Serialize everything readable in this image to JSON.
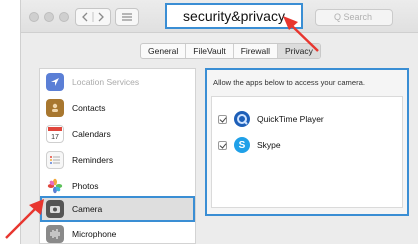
{
  "window": {
    "title": "security&privacy",
    "search_placeholder": "Q Search",
    "nav_back": "<",
    "nav_forward": ">"
  },
  "tabs": [
    {
      "label": "General",
      "active": false
    },
    {
      "label": "FileVault",
      "active": false
    },
    {
      "label": "Firewall",
      "active": false
    },
    {
      "label": "Privacy",
      "active": true
    }
  ],
  "sidebar": {
    "items": [
      {
        "label": "Location Services",
        "icon": "location-arrow-icon",
        "color": "#5b7fd6"
      },
      {
        "label": "Contacts",
        "icon": "contacts-book-icon",
        "color": "#a8772f"
      },
      {
        "label": "Calendars",
        "icon": "calendar-icon",
        "color": "#e0463c"
      },
      {
        "label": "Reminders",
        "icon": "reminders-list-icon",
        "color": "#f0f0f0"
      },
      {
        "label": "Photos",
        "icon": "photos-flower-icon",
        "color": "#f2a93b"
      },
      {
        "label": "Camera",
        "icon": "camera-icon",
        "color": "#555555"
      },
      {
        "label": "Microphone",
        "icon": "microphone-icon",
        "color": "#8a8a8a"
      }
    ],
    "selected": "Camera"
  },
  "panel": {
    "description": "Allow the apps below to access your camera.",
    "apps": [
      {
        "name": "QuickTime Player",
        "checked": true,
        "icon": "quicktime-icon",
        "color": "#1d5fb8"
      },
      {
        "name": "Skype",
        "checked": true,
        "icon": "skype-icon",
        "color": "#1fa0e8"
      }
    ]
  },
  "annotations": {
    "highlight_color": "#3a8ed4",
    "arrow_color": "#e8362f"
  }
}
